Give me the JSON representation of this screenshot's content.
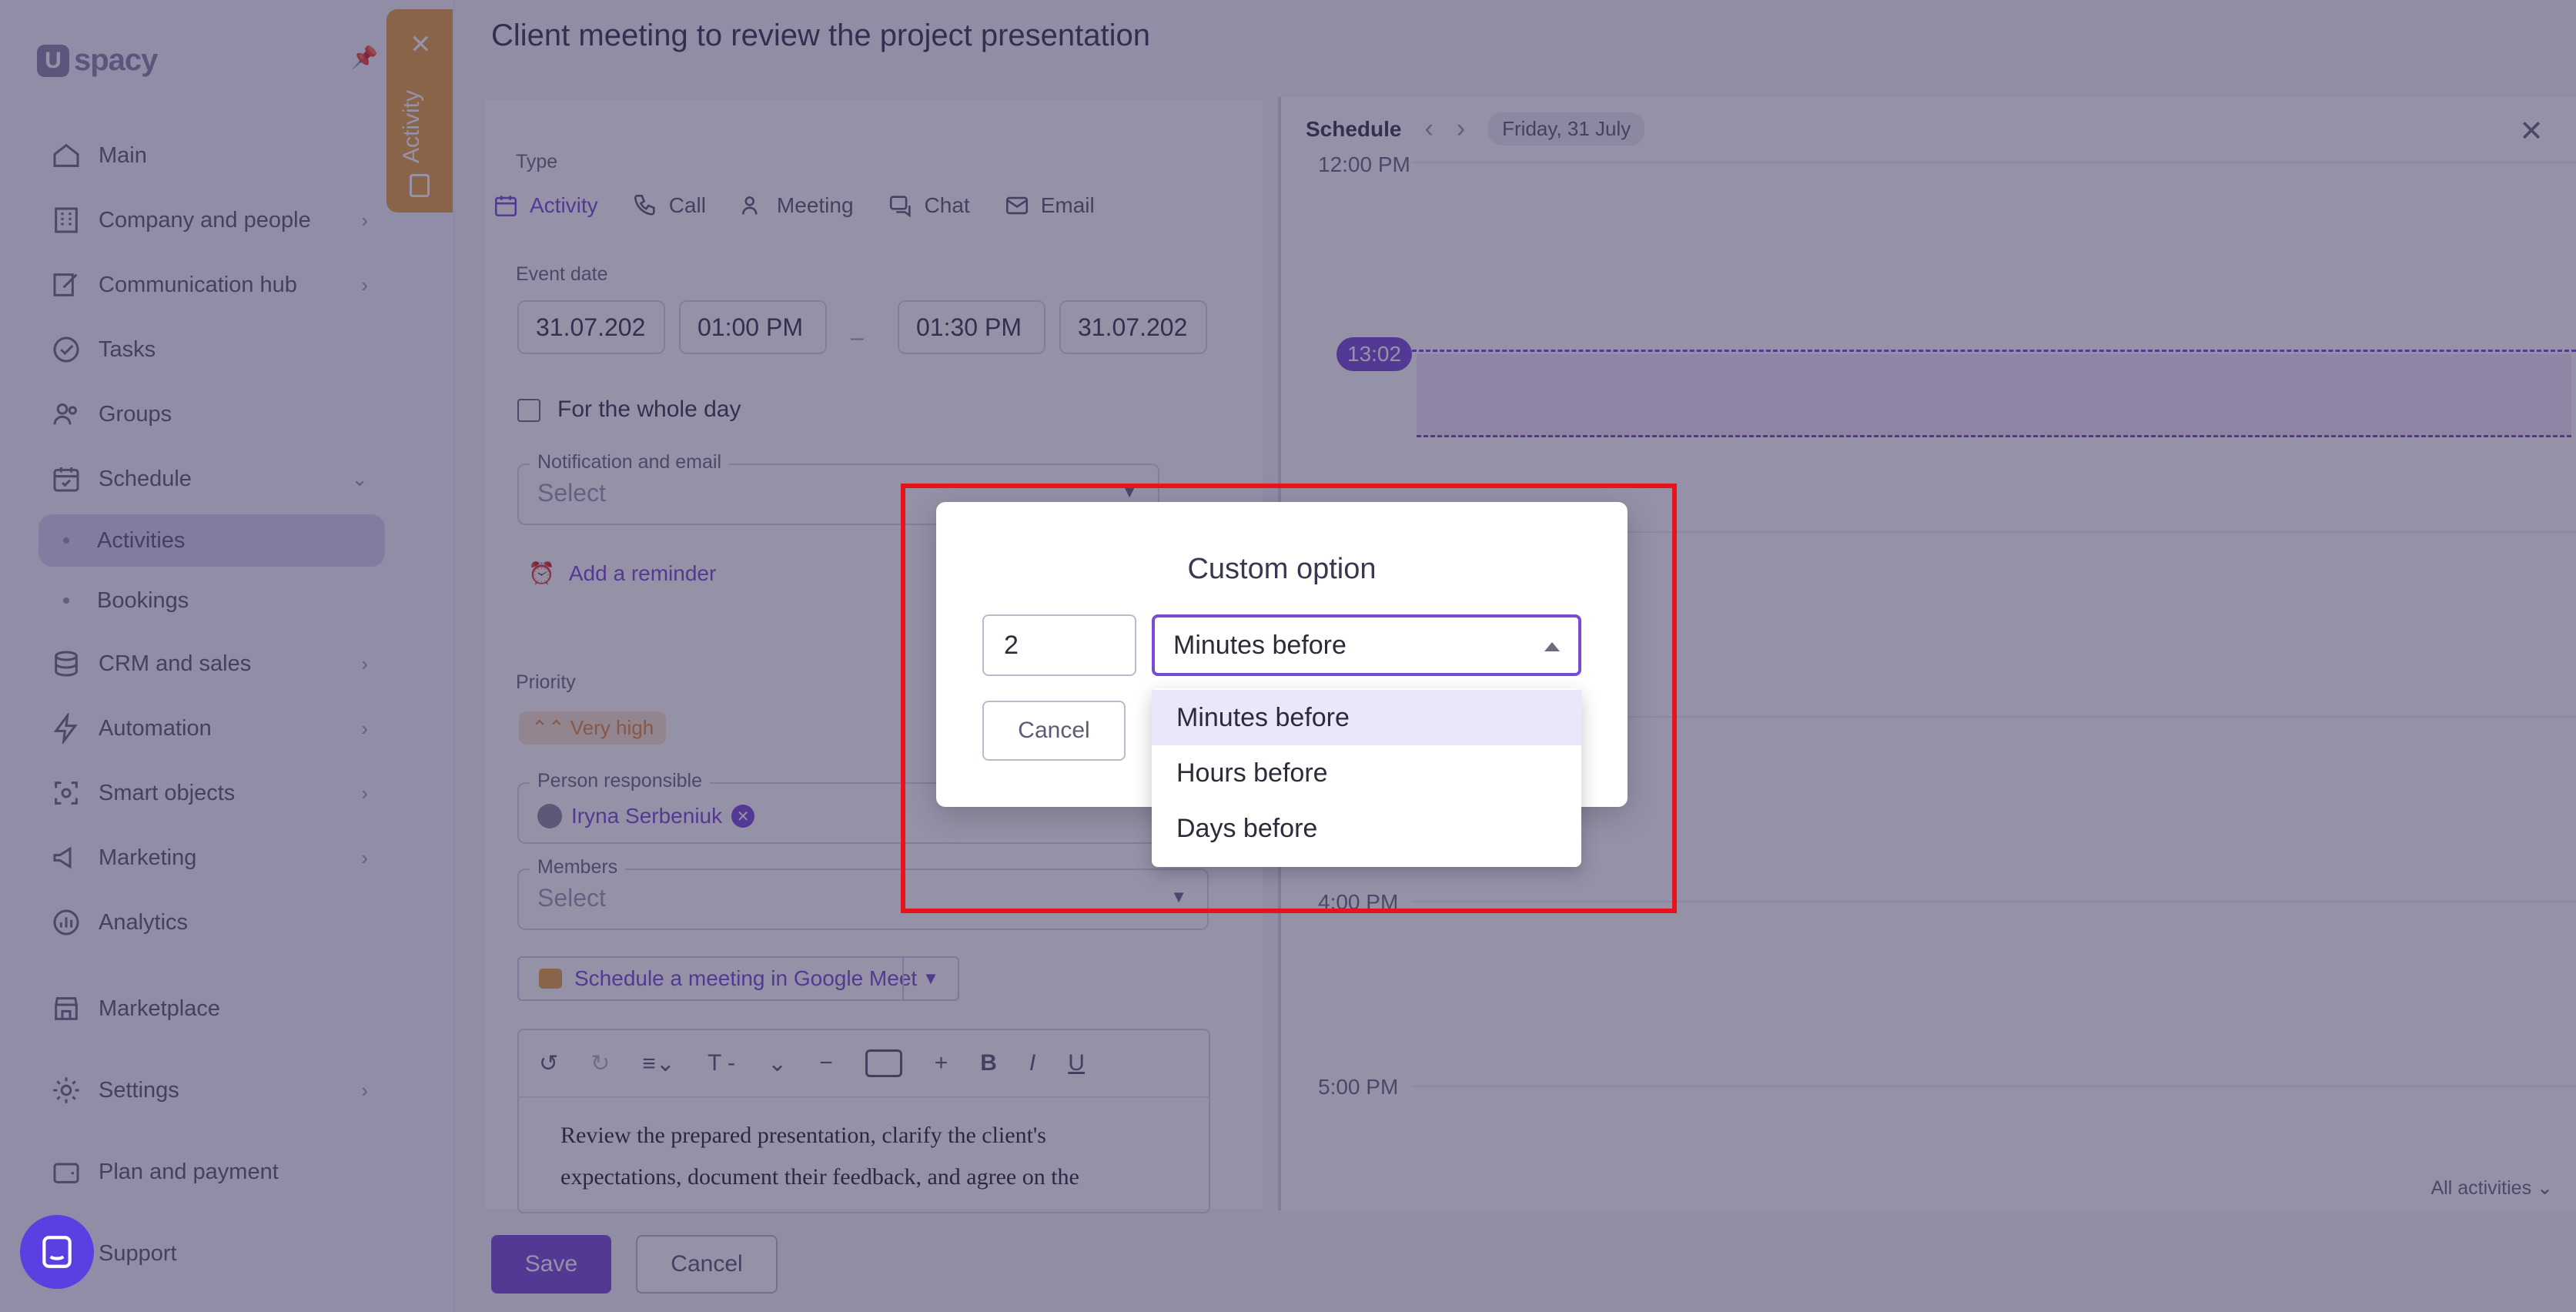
{
  "brand": {
    "name": "spacy",
    "mark": "U"
  },
  "activity_tab": {
    "label": "Activity"
  },
  "sidebar": {
    "items": [
      {
        "label": "Main",
        "icon": "home-icon",
        "chevron": false
      },
      {
        "label": "Company and people",
        "icon": "building-icon",
        "chevron": true
      },
      {
        "label": "Communication hub",
        "icon": "edit-icon",
        "chevron": true
      },
      {
        "label": "Tasks",
        "icon": "check-circle-icon",
        "chevron": false
      },
      {
        "label": "Groups",
        "icon": "users-icon",
        "chevron": false
      },
      {
        "label": "Schedule",
        "icon": "calendar-icon",
        "chevron": true
      },
      {
        "label": "Activities",
        "sub": true,
        "active": true
      },
      {
        "label": "Bookings",
        "sub": true
      },
      {
        "label": "CRM and sales",
        "icon": "coins-icon",
        "chevron": true
      },
      {
        "label": "Automation",
        "icon": "lightning-icon",
        "chevron": true
      },
      {
        "label": "Smart objects",
        "icon": "smart-object-icon",
        "chevron": true
      },
      {
        "label": "Marketing",
        "icon": "megaphone-icon",
        "chevron": true
      },
      {
        "label": "Analytics",
        "icon": "analytics-icon",
        "chevron": false
      },
      {
        "label": "Marketplace",
        "icon": "store-icon",
        "chevron": false
      },
      {
        "label": "Settings",
        "icon": "gear-icon",
        "chevron": true
      },
      {
        "label": "Plan and payment",
        "icon": "wallet-icon",
        "chevron": false
      },
      {
        "label": "Support",
        "icon": "support-icon",
        "chevron": false
      }
    ]
  },
  "page": {
    "title": "Client meeting to review the project presentation"
  },
  "form": {
    "type_label": "Type",
    "types": [
      "Activity",
      "Call",
      "Meeting",
      "Chat",
      "Email"
    ],
    "event_date_label": "Event date",
    "start_date": "31.07.202",
    "start_time": "01:00 PM",
    "date_separator": "–",
    "end_time": "01:30 PM",
    "end_date": "31.07.202",
    "whole_day_label": "For the whole day",
    "notification_label": "Notification and email",
    "notification_placeholder": "Select",
    "add_reminder_label": "Add a reminder",
    "priority_label": "Priority",
    "priority_value": "Very high",
    "person_label": "Person responsible",
    "person_value": "Iryna Serbeniuk",
    "members_label": "Members",
    "members_placeholder": "Select",
    "meet_button_label": "Schedule a meeting in Google Meet",
    "editor_text": "Review the prepared presentation, clarify the client's expectations, document their feedback, and agree on the",
    "save_label": "Save",
    "cancel_label": "Cancel"
  },
  "schedule": {
    "title": "Schedule",
    "date": "Friday, 31 July",
    "time_labels": [
      "12:00 PM",
      "4:00 PM",
      "5:00 PM"
    ],
    "now_time": "13:02",
    "filter_label": "All activities"
  },
  "modal": {
    "title": "Custom option",
    "number_value": "2",
    "selected_unit": "Minutes before",
    "cancel_label": "Cancel",
    "options": [
      "Minutes before",
      "Hours before",
      "Days before"
    ]
  },
  "colors": {
    "accent": "#7b4bd6",
    "highlight": "#e8141c",
    "priority": "#e08a3c",
    "activity_tab": "#e7a33f"
  }
}
